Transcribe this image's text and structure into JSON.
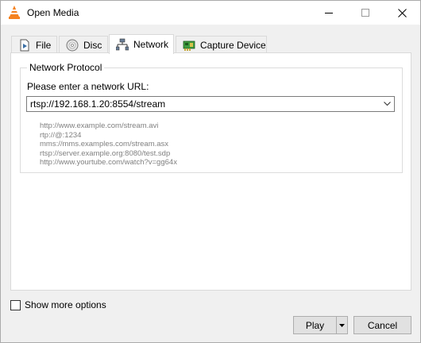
{
  "window": {
    "title": "Open Media"
  },
  "tabs": [
    {
      "label": "File",
      "icon": "file-icon"
    },
    {
      "label": "Disc",
      "icon": "disc-icon"
    },
    {
      "label": "Network",
      "icon": "network-icon",
      "active": true
    },
    {
      "label": "Capture Device",
      "icon": "capture-card-icon"
    }
  ],
  "network": {
    "group_title": "Network Protocol",
    "url_label": "Please enter a network URL:",
    "url_value": "rtsp://192.168.1.20:8554/stream",
    "examples": [
      "http://www.example.com/stream.avi",
      "rtp://@:1234",
      "mms://mms.examples.com/stream.asx",
      "rtsp://server.example.org:8080/test.sdp",
      "http://www.yourtube.com/watch?v=gg64x"
    ]
  },
  "options": {
    "show_more_label": "Show more options",
    "show_more_checked": false
  },
  "buttons": {
    "play_label": "Play",
    "cancel_label": "Cancel"
  },
  "colors": {
    "vlc_orange": "#f58220",
    "tab_active_bg": "#ffffff",
    "window_bg": "#f0f0f0"
  }
}
